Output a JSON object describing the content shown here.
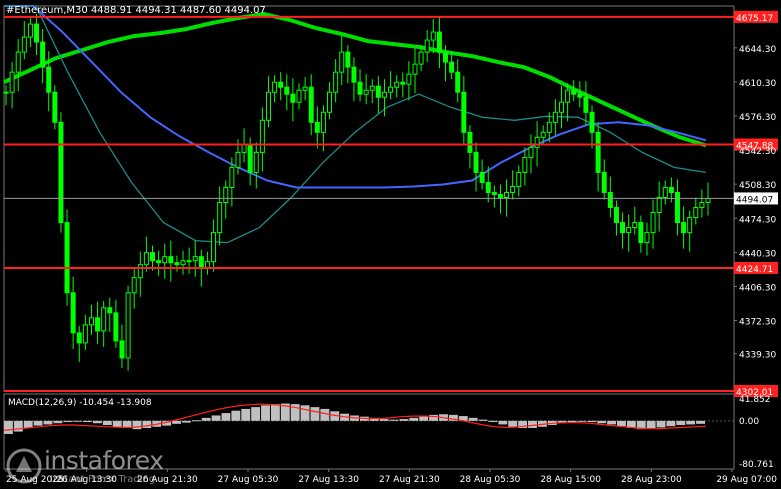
{
  "chart_data": {
    "type": "candlestick",
    "header": "#Ethereum,M30  4488.91 4494.31 4487.60 4494.07",
    "price_axis": [
      4644.3,
      4610.3,
      4576.3,
      4542.3,
      4508.3,
      4474.3,
      4440.3,
      4406.3,
      4372.3,
      4339.3
    ],
    "ylim": [
      4302.01,
      4686.0
    ],
    "time_labels": [
      "25 Aug 2025",
      "26 Aug 13:30",
      "26 Aug 21:30",
      "27 Aug 05:30",
      "27 Aug 13:30",
      "27 Aug 21:30",
      "28 Aug 05:30",
      "28 Aug 15:00",
      "28 Aug 23:00",
      "29 Aug 07:00"
    ],
    "levels": [
      {
        "price": 4675.17,
        "label": "4675.17",
        "color": "#ff2020"
      },
      {
        "price": 4547.88,
        "label": "4547.88",
        "color": "#ff2020"
      },
      {
        "price": 4424.71,
        "label": "4424.71",
        "color": "#ff2020"
      },
      {
        "price": 4302.01,
        "label": "4302.01",
        "color": "#ff2020"
      }
    ],
    "current_price": {
      "price": 4494.07,
      "label": "4494.07"
    },
    "close_series": [
      4600,
      4620,
      4640,
      4655,
      4668,
      4650,
      4625,
      4600,
      4570,
      4470,
      4400,
      4360,
      4350,
      4368,
      4375,
      4362,
      4385,
      4380,
      4352,
      4335,
      4400,
      4415,
      4428,
      4440,
      4432,
      4430,
      4436,
      4430,
      4428,
      4432,
      4432,
      4436,
      4425,
      4431,
      4460,
      4490,
      4505,
      4525,
      4540,
      4548,
      4520,
      4540,
      4572,
      4600,
      4610,
      4605,
      4598,
      4590,
      4602,
      4605,
      4570,
      4560,
      4580,
      4600,
      4620,
      4640,
      4625,
      4610,
      4598,
      4602,
      4606,
      4595,
      4600,
      4605,
      4610,
      4608,
      4618,
      4628,
      4640,
      4652,
      4660,
      4640,
      4630,
      4620,
      4600,
      4560,
      4540,
      4520,
      4510,
      4500,
      4498,
      4495,
      4500,
      4506,
      4520,
      4535,
      4545,
      4555,
      4560,
      4570,
      4580,
      4590,
      4602,
      4598,
      4595,
      4580,
      4560,
      4520,
      4500,
      4485,
      4470,
      4460,
      4465,
      4470,
      4450,
      4460,
      4480,
      4495,
      4505,
      4500,
      4470,
      4460,
      4475,
      4485,
      4490,
      4494
    ],
    "moving_averages": [
      {
        "color": "#00dd00",
        "points": [
          4610,
          4622,
          4634,
          4642,
          4650,
          4656,
          4659,
          4663,
          4669,
          4674,
          4678,
          4672,
          4664,
          4658,
          4651,
          4648,
          4645,
          4640,
          4636,
          4630,
          4625,
          4615,
          4602,
          4590,
          4578,
          4566,
          4555,
          4547
        ]
      },
      {
        "color": "#4466ff",
        "points": [
          4740,
          4700,
          4660,
          4630,
          4600,
          4575,
          4556,
          4540,
          4525,
          4512,
          4505,
          4505,
          4505,
          4505,
          4506,
          4508,
          4512,
          4530,
          4545,
          4558,
          4568,
          4570,
          4567,
          4560,
          4552
        ]
      },
      {
        "color": "#1e8a8a",
        "points": [
          4760,
          4700,
          4620,
          4560,
          4510,
          4470,
          4452,
          4450,
          4465,
          4495,
          4530,
          4560,
          4585,
          4598,
          4585,
          4575,
          4572,
          4576,
          4575,
          4560,
          4540,
          4525,
          4520
        ]
      }
    ],
    "indicator": {
      "label": "MACD(12,26,9) -10.454 -13.908",
      "axis_labels": [
        "41.852",
        "0.00",
        "-80.761"
      ],
      "ylim": [
        -80.761,
        45.0
      ],
      "histogram": [
        -22,
        -18,
        -12,
        -8,
        -6,
        -4,
        -2,
        -1,
        -2,
        -4,
        -7,
        -10,
        -12,
        -14,
        -12,
        -10,
        -8,
        -5,
        -3,
        1,
        5,
        9,
        13,
        17,
        20,
        23,
        26,
        28,
        29,
        28,
        26,
        23,
        20,
        16,
        12,
        9,
        7,
        5,
        3,
        2,
        3,
        5,
        8,
        10,
        11,
        10,
        8,
        5,
        2,
        -2,
        -6,
        -10,
        -12,
        -12,
        -10,
        -7,
        -4,
        -2,
        -1,
        -2,
        -4,
        -6,
        -9,
        -12,
        -14,
        -13,
        -11,
        -9,
        -7,
        -6,
        -5
      ],
      "signal": [
        -16,
        -14,
        -12,
        -10,
        -8,
        -7,
        -7,
        -8,
        -9,
        -10,
        -11,
        -11,
        -9,
        -6,
        -2,
        3,
        8,
        13,
        18,
        22,
        25,
        27,
        28,
        27,
        25,
        22,
        18,
        14,
        10,
        7,
        5,
        4,
        4,
        5,
        7,
        8,
        8,
        7,
        4,
        1,
        -3,
        -7,
        -10,
        -11,
        -10,
        -8,
        -6,
        -4,
        -3,
        -3,
        -4,
        -6,
        -8,
        -10,
        -12,
        -13,
        -13,
        -12,
        -11,
        -10,
        -9
      ]
    }
  },
  "watermark": {
    "name": "instaforex",
    "tagline": "Instant Forex Trading"
  }
}
